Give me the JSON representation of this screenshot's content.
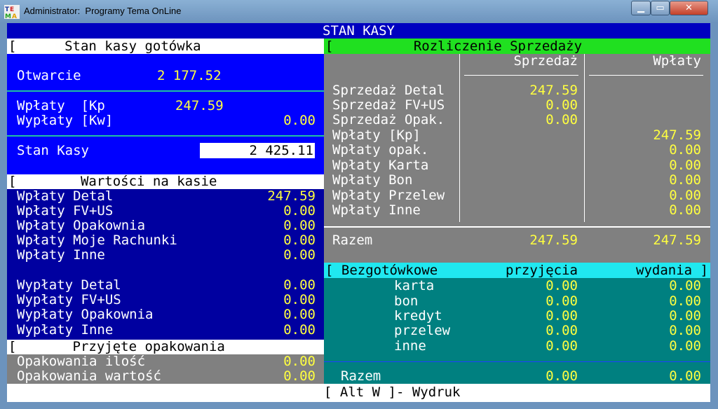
{
  "window": {
    "title": "Administrator:  Programy Tema OnLine",
    "buttons": {
      "minimize": "▁",
      "maximize": "▭",
      "close": "✕"
    }
  },
  "header": {
    "title": "STAN KASY"
  },
  "cash": {
    "section_title": "[      Stan kasy gotówka                   ]",
    "otwarcie_label": "Otwarcie",
    "otwarcie_value": "2 177.52",
    "wplaty_label": "Wpłaty  [Kp",
    "wplaty_value": "247.59",
    "wyplaty_label": "Wypłaty [Kw]",
    "wyplaty_value": "0.00",
    "stan_label": "Stan Kasy",
    "stan_value": "2 425.11"
  },
  "values": {
    "section_title": "[        Wartości na kasie                 ]",
    "rows": [
      {
        "label": "Wpłaty Detal",
        "value": "247.59"
      },
      {
        "label": "Wpłaty FV+US",
        "value": "0.00"
      },
      {
        "label": "Wpłaty Opakownia",
        "value": "0.00"
      },
      {
        "label": "Wpłaty Moje Rachunki",
        "value": "0.00"
      },
      {
        "label": "Wpłaty Inne",
        "value": "0.00"
      },
      {
        "label": "Wypłaty Detal",
        "value": "0.00"
      },
      {
        "label": "Wypłaty FV+US",
        "value": "0.00"
      },
      {
        "label": "Wypłaty Opakownia",
        "value": "0.00"
      },
      {
        "label": "Wypłaty Inne",
        "value": "0.00"
      }
    ]
  },
  "packaging": {
    "section_title": "[       Przyjęte opakowania                ]",
    "rows": [
      {
        "label": "Opakowania ilość",
        "value": "0.00"
      },
      {
        "label": "Opakowania wartość",
        "value": "0.00"
      }
    ]
  },
  "settlement": {
    "section_title": "[          Rozliczenie Sprzedaży                    ]",
    "col_sales": "Sprzedaż",
    "col_payments": "Wpłaty",
    "rows": [
      {
        "label": "Sprzedaż Detal",
        "sales": "247.59",
        "payments": ""
      },
      {
        "label": "Sprzedaż FV+US",
        "sales": "0.00",
        "payments": ""
      },
      {
        "label": "Sprzedaż Opak.",
        "sales": "0.00",
        "payments": ""
      },
      {
        "label": "Wpłaty [Kp]",
        "sales": "",
        "payments": "247.59"
      },
      {
        "label": "Wpłaty opak.",
        "sales": "",
        "payments": "0.00"
      },
      {
        "label": "Wpłaty Karta",
        "sales": "",
        "payments": "0.00"
      },
      {
        "label": "Wpłaty Bon",
        "sales": "",
        "payments": "0.00"
      },
      {
        "label": "Wpłaty Przelew",
        "sales": "",
        "payments": "0.00"
      },
      {
        "label": "Wpłaty Inne",
        "sales": "",
        "payments": "0.00"
      }
    ],
    "total_label": "Razem",
    "total_sales": "247.59",
    "total_payments": "247.59"
  },
  "noncash": {
    "header_label": "[ Bezgotówkowe",
    "col_in": "przyjęcia",
    "col_out": "wydania ]",
    "rows": [
      {
        "label": "karta",
        "in": "0.00",
        "out": "0.00"
      },
      {
        "label": "bon",
        "in": "0.00",
        "out": "0.00"
      },
      {
        "label": "kredyt",
        "in": "0.00",
        "out": "0.00"
      },
      {
        "label": "przelew",
        "in": "0.00",
        "out": "0.00"
      },
      {
        "label": "inne",
        "in": "0.00",
        "out": "0.00"
      }
    ],
    "total_label": "Razem",
    "total_in": "0.00",
    "total_out": "0.00"
  },
  "footer": {
    "hint": "[ Alt W ]- Wydruk"
  }
}
